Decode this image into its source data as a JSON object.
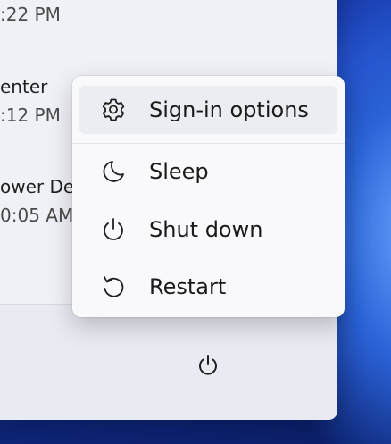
{
  "recommended": [
    {
      "line": ":22 PM"
    },
    {
      "line": "enter"
    },
    {
      "line": ":12 PM"
    },
    {
      "line": "ower De"
    },
    {
      "line": "0:05 AM"
    }
  ],
  "power_menu": {
    "items": [
      {
        "label": "Sign-in options",
        "icon": "gear-icon"
      },
      {
        "label": "Sleep",
        "icon": "moon-icon"
      },
      {
        "label": "Shut down",
        "icon": "power-icon"
      },
      {
        "label": "Restart",
        "icon": "restart-icon"
      }
    ]
  },
  "colors": {
    "menu_bg": "#f9f9fb",
    "hover_bg": "#ecedf2",
    "wallpaper_primary": "#1f46c4"
  }
}
